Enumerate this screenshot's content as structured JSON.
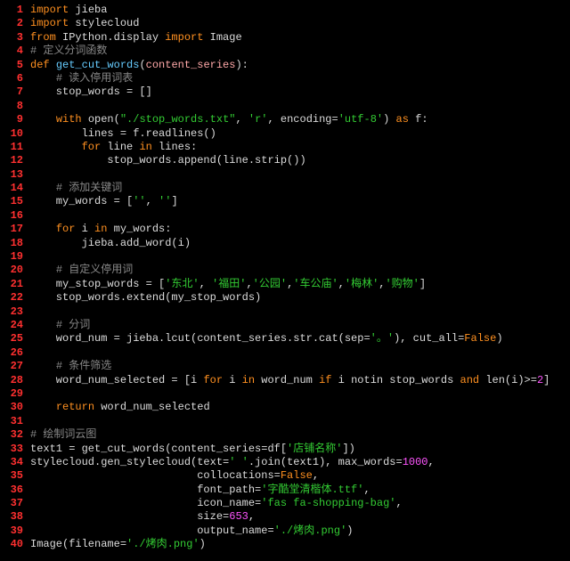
{
  "lines": [
    {
      "n": 1,
      "tokens": [
        {
          "c": "kw",
          "t": "import"
        },
        {
          "c": "id",
          "t": " jieba"
        }
      ]
    },
    {
      "n": 2,
      "tokens": [
        {
          "c": "kw",
          "t": "import"
        },
        {
          "c": "id",
          "t": " stylecloud"
        }
      ]
    },
    {
      "n": 3,
      "tokens": [
        {
          "c": "kw",
          "t": "from"
        },
        {
          "c": "id",
          "t": " IPython.display "
        },
        {
          "c": "kw",
          "t": "import"
        },
        {
          "c": "id",
          "t": " Image"
        }
      ]
    },
    {
      "n": 4,
      "tokens": [
        {
          "c": "cm",
          "t": "# 定义分词函数"
        }
      ]
    },
    {
      "n": 5,
      "tokens": [
        {
          "c": "kw",
          "t": "def"
        },
        {
          "c": "id",
          "t": " "
        },
        {
          "c": "fn",
          "t": "get_cut_words"
        },
        {
          "c": "id",
          "t": "("
        },
        {
          "c": "arg",
          "t": "content_series"
        },
        {
          "c": "id",
          "t": "):"
        }
      ]
    },
    {
      "n": 6,
      "tokens": [
        {
          "c": "id",
          "t": "    "
        },
        {
          "c": "cm",
          "t": "# 读入停用词表"
        }
      ]
    },
    {
      "n": 7,
      "tokens": [
        {
          "c": "id",
          "t": "    stop_words = []"
        }
      ]
    },
    {
      "n": 8,
      "tokens": []
    },
    {
      "n": 9,
      "tokens": [
        {
          "c": "id",
          "t": "    "
        },
        {
          "c": "kw",
          "t": "with"
        },
        {
          "c": "id",
          "t": " open("
        },
        {
          "c": "st",
          "t": "\"./stop_words.txt\""
        },
        {
          "c": "id",
          "t": ", "
        },
        {
          "c": "st",
          "t": "'r'"
        },
        {
          "c": "id",
          "t": ", encoding="
        },
        {
          "c": "st",
          "t": "'utf-8'"
        },
        {
          "c": "id",
          "t": ") "
        },
        {
          "c": "kw",
          "t": "as"
        },
        {
          "c": "id",
          "t": " f:"
        }
      ]
    },
    {
      "n": 10,
      "tokens": [
        {
          "c": "id",
          "t": "        lines = f.readlines()"
        }
      ]
    },
    {
      "n": 11,
      "tokens": [
        {
          "c": "id",
          "t": "        "
        },
        {
          "c": "kw",
          "t": "for"
        },
        {
          "c": "id",
          "t": " line "
        },
        {
          "c": "kw",
          "t": "in"
        },
        {
          "c": "id",
          "t": " lines:"
        }
      ]
    },
    {
      "n": 12,
      "tokens": [
        {
          "c": "id",
          "t": "            stop_words.append(line.strip())"
        }
      ]
    },
    {
      "n": 13,
      "tokens": []
    },
    {
      "n": 14,
      "tokens": [
        {
          "c": "id",
          "t": "    "
        },
        {
          "c": "cm",
          "t": "# 添加关键词"
        }
      ]
    },
    {
      "n": 15,
      "tokens": [
        {
          "c": "id",
          "t": "    my_words = ["
        },
        {
          "c": "st",
          "t": "''"
        },
        {
          "c": "id",
          "t": ", "
        },
        {
          "c": "st",
          "t": "''"
        },
        {
          "c": "id",
          "t": "]"
        }
      ]
    },
    {
      "n": 16,
      "tokens": []
    },
    {
      "n": 17,
      "tokens": [
        {
          "c": "id",
          "t": "    "
        },
        {
          "c": "kw",
          "t": "for"
        },
        {
          "c": "id",
          "t": " i "
        },
        {
          "c": "kw",
          "t": "in"
        },
        {
          "c": "id",
          "t": " my_words:"
        }
      ]
    },
    {
      "n": 18,
      "tokens": [
        {
          "c": "id",
          "t": "        jieba.add_word(i)"
        }
      ]
    },
    {
      "n": 19,
      "tokens": []
    },
    {
      "n": 20,
      "tokens": [
        {
          "c": "id",
          "t": "    "
        },
        {
          "c": "cm",
          "t": "# 自定义停用词"
        }
      ]
    },
    {
      "n": 21,
      "tokens": [
        {
          "c": "id",
          "t": "    my_stop_words = ["
        },
        {
          "c": "st",
          "t": "'东北'"
        },
        {
          "c": "id",
          "t": ", "
        },
        {
          "c": "st",
          "t": "'福田'"
        },
        {
          "c": "id",
          "t": ","
        },
        {
          "c": "st",
          "t": "'公园'"
        },
        {
          "c": "id",
          "t": ","
        },
        {
          "c": "st",
          "t": "'车公庙'"
        },
        {
          "c": "id",
          "t": ","
        },
        {
          "c": "st",
          "t": "'梅林'"
        },
        {
          "c": "id",
          "t": ","
        },
        {
          "c": "st",
          "t": "'购物'"
        },
        {
          "c": "id",
          "t": "]"
        }
      ]
    },
    {
      "n": 22,
      "tokens": [
        {
          "c": "id",
          "t": "    stop_words.extend(my_stop_words)"
        }
      ]
    },
    {
      "n": 23,
      "tokens": []
    },
    {
      "n": 24,
      "tokens": [
        {
          "c": "id",
          "t": "    "
        },
        {
          "c": "cm",
          "t": "# 分词"
        }
      ]
    },
    {
      "n": 25,
      "tokens": [
        {
          "c": "id",
          "t": "    word_num = jieba.lcut(content_series.str.cat(sep="
        },
        {
          "c": "st",
          "t": "'。'"
        },
        {
          "c": "id",
          "t": "), cut_all="
        },
        {
          "c": "bool",
          "t": "False"
        },
        {
          "c": "id",
          "t": ")"
        }
      ]
    },
    {
      "n": 26,
      "tokens": []
    },
    {
      "n": 27,
      "tokens": [
        {
          "c": "id",
          "t": "    "
        },
        {
          "c": "cm",
          "t": "# 条件筛选"
        }
      ]
    },
    {
      "n": 28,
      "tokens": [
        {
          "c": "id",
          "t": "    word_num_selected = [i "
        },
        {
          "c": "kw",
          "t": "for"
        },
        {
          "c": "id",
          "t": " i "
        },
        {
          "c": "kw",
          "t": "in"
        },
        {
          "c": "id",
          "t": " word_num "
        },
        {
          "c": "kw",
          "t": "if"
        },
        {
          "c": "id",
          "t": " i notin stop_words "
        },
        {
          "c": "kw",
          "t": "and"
        },
        {
          "c": "id",
          "t": " len(i)>="
        },
        {
          "c": "num",
          "t": "2"
        },
        {
          "c": "id",
          "t": "]"
        }
      ]
    },
    {
      "n": 29,
      "tokens": []
    },
    {
      "n": 30,
      "tokens": [
        {
          "c": "id",
          "t": "    "
        },
        {
          "c": "kw",
          "t": "return"
        },
        {
          "c": "id",
          "t": " word_num_selected"
        }
      ]
    },
    {
      "n": 31,
      "tokens": []
    },
    {
      "n": 32,
      "tokens": [
        {
          "c": "cm",
          "t": "# 绘制词云图"
        }
      ]
    },
    {
      "n": 33,
      "tokens": [
        {
          "c": "id",
          "t": "text1 = get_cut_words(content_series=df["
        },
        {
          "c": "st",
          "t": "'店铺名称'"
        },
        {
          "c": "id",
          "t": "])"
        }
      ]
    },
    {
      "n": 34,
      "tokens": [
        {
          "c": "id",
          "t": "stylecloud.gen_stylecloud(text="
        },
        {
          "c": "st",
          "t": "' '"
        },
        {
          "c": "id",
          "t": ".join(text1), max_words="
        },
        {
          "c": "num",
          "t": "1000"
        },
        {
          "c": "id",
          "t": ","
        }
      ]
    },
    {
      "n": 35,
      "tokens": [
        {
          "c": "id",
          "t": "                          collocations="
        },
        {
          "c": "bool",
          "t": "False"
        },
        {
          "c": "id",
          "t": ","
        }
      ]
    },
    {
      "n": 36,
      "tokens": [
        {
          "c": "id",
          "t": "                          font_path="
        },
        {
          "c": "st",
          "t": "'字酷堂清楷体.ttf'"
        },
        {
          "c": "id",
          "t": ","
        }
      ]
    },
    {
      "n": 37,
      "tokens": [
        {
          "c": "id",
          "t": "                          icon_name="
        },
        {
          "c": "st",
          "t": "'fas fa-shopping-bag'"
        },
        {
          "c": "id",
          "t": ","
        }
      ]
    },
    {
      "n": 38,
      "tokens": [
        {
          "c": "id",
          "t": "                          size="
        },
        {
          "c": "num",
          "t": "653"
        },
        {
          "c": "id",
          "t": ","
        }
      ]
    },
    {
      "n": 39,
      "tokens": [
        {
          "c": "id",
          "t": "                          output_name="
        },
        {
          "c": "st",
          "t": "'./烤肉.png'"
        },
        {
          "c": "id",
          "t": ")"
        }
      ]
    },
    {
      "n": 40,
      "tokens": [
        {
          "c": "id",
          "t": "Image(filename="
        },
        {
          "c": "st",
          "t": "'./烤肉.png'"
        },
        {
          "c": "id",
          "t": ")"
        }
      ]
    }
  ]
}
